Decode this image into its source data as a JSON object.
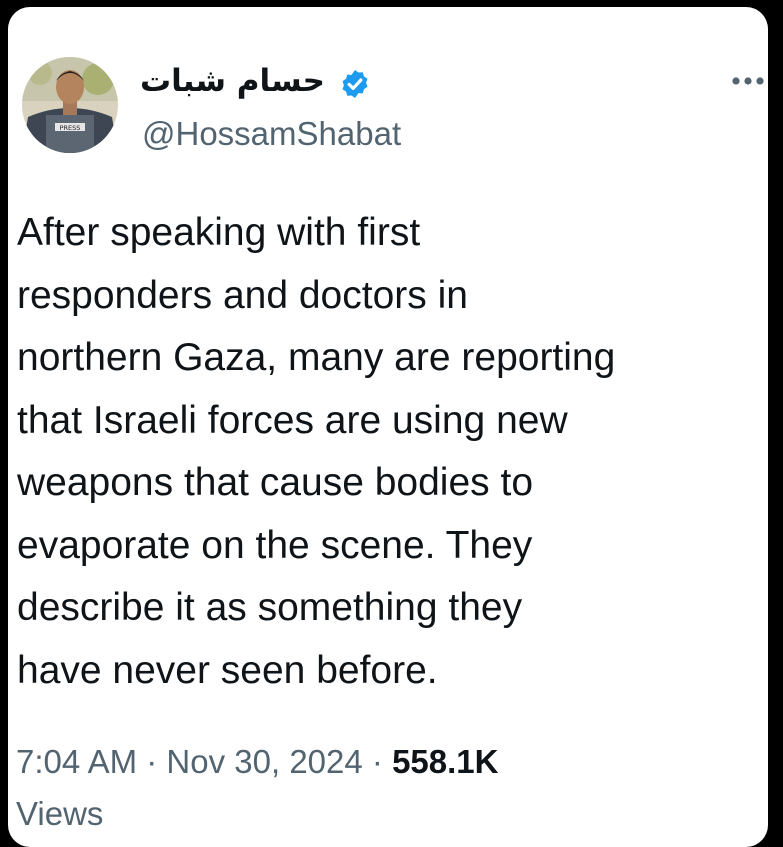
{
  "tweet": {
    "display_name": "حسام شبات",
    "handle": "@HossamShabat",
    "avatar_badge_text": "PRESS",
    "text_lines": [
      "After speaking with first",
      "responders and doctors in",
      "northern Gaza, many are reporting",
      "that Israeli forces are using new",
      "weapons that cause bodies to",
      "evaporate on the scene. They",
      "describe it as something they",
      "have never seen before."
    ],
    "time": "7:04 AM",
    "date": "Nov 30, 2024",
    "separator": "·",
    "views_count": "558.1K",
    "views_label": "Views"
  },
  "icons": {
    "verified": "verified-badge-icon",
    "more": "more-options-icon"
  },
  "colors": {
    "background": "#000000",
    "card": "#ffffff",
    "text_primary": "#0f1419",
    "text_secondary": "#536471",
    "verified_blue": "#1d9bf0"
  }
}
